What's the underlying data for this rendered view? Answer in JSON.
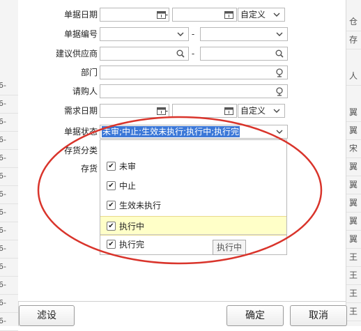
{
  "background_left_rows": [
    "6-",
    "6-",
    "6-",
    "6-",
    "6-",
    "6-",
    "6-",
    "6-",
    "6-",
    "6-",
    "6-",
    "6-",
    "6-",
    "6-"
  ],
  "background_right_rows": [
    "仓",
    "存",
    "",
    "人",
    "翼",
    "翼",
    "宋",
    "翼",
    "翼",
    "翼",
    "翼",
    "翼",
    "王",
    "王",
    "王",
    "王",
    "王"
  ],
  "form": {
    "doc_date_label": "单据日期",
    "doc_date_mode": "自定义",
    "doc_no_label": "单据编号",
    "supplier_label": "建议供应商",
    "dept_label": "部门",
    "requester_label": "请购人",
    "need_date_label": "需求日期",
    "need_date_mode": "自定义",
    "status_label": "单据状态",
    "status_value": "未审;中止;生效未执行;执行中;执行完",
    "stock_category_label": "存货分类",
    "stock_label": "存货"
  },
  "dropdown": {
    "options": [
      {
        "label": "未审",
        "checked": true
      },
      {
        "label": "中止",
        "checked": true
      },
      {
        "label": "生效未执行",
        "checked": true
      },
      {
        "label": "执行中",
        "checked": true,
        "highlighted": true
      },
      {
        "label": "执行完",
        "checked": true
      }
    ],
    "tooltip": "执行中"
  },
  "buttons": {
    "filter_label": "滤设",
    "ok_label": "确定",
    "cancel_label": "取消"
  },
  "colors": {
    "selection": "#3c78d8",
    "highlight_row": "#ffffc8",
    "annotation_ellipse": "#d9342b"
  },
  "icons": {
    "calendar": "calendar-icon",
    "dropdown": "chevron-down-icon",
    "search": "search-icon",
    "person_search": "person-search-icon",
    "checkbox": "checkbox-checked-icon"
  }
}
